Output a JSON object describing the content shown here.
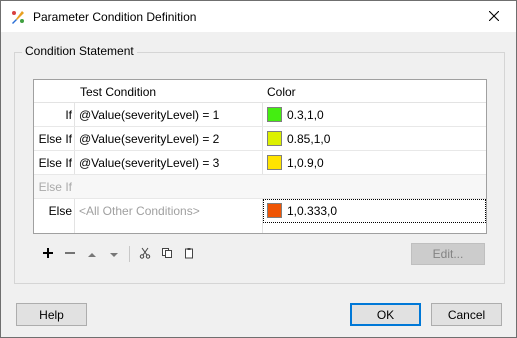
{
  "window": {
    "title": "Parameter Condition Definition"
  },
  "group": {
    "title": "Condition Statement"
  },
  "grid": {
    "headers": {
      "test_condition": "Test Condition",
      "color": "Color"
    },
    "rows": [
      {
        "label": "If",
        "condition": "@Value(severityLevel) = 1",
        "swatch": "#44ee11",
        "color_value": "0.3,1,0"
      },
      {
        "label": "Else If",
        "condition": "@Value(severityLevel) = 2",
        "swatch": "#dcf000",
        "color_value": "0.85,1,0"
      },
      {
        "label": "Else If",
        "condition": "@Value(severityLevel) = 3",
        "swatch": "#ffe400",
        "color_value": "1,0.9,0"
      },
      {
        "label": "Else If",
        "condition": "",
        "swatch": "",
        "color_value": ""
      },
      {
        "label": "Else",
        "condition": "<All Other Conditions>",
        "swatch": "#ef5505",
        "color_value": "1,0.333,0"
      }
    ]
  },
  "toolbar": {
    "edit_label": "Edit..."
  },
  "buttons": {
    "help": "Help",
    "ok": "OK",
    "cancel": "Cancel"
  },
  "icons": {
    "app": "paintbrush-icon",
    "close": "close-icon",
    "add": "plus-icon",
    "remove": "minus-icon",
    "up": "arrow-up-icon",
    "down": "arrow-down-icon",
    "cut": "scissors-icon",
    "copy": "copy-icon",
    "paste": "clipboard-icon"
  }
}
